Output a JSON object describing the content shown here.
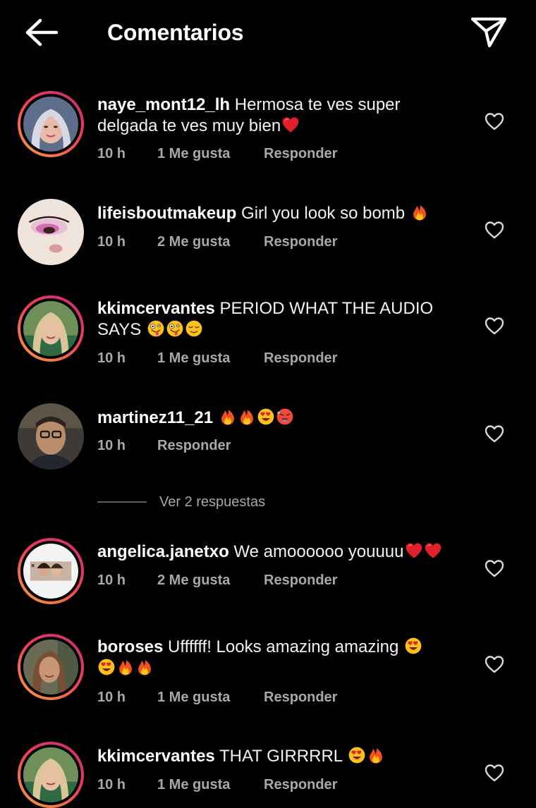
{
  "header": {
    "title": "Comentarios",
    "back_icon": "arrow-left-icon",
    "send_icon": "paper-plane-icon"
  },
  "colors": {
    "background": "#000000",
    "text": "#ffffff",
    "secondary_text": "#a8a8a8",
    "story_ring_start": "#f6a23a",
    "story_ring_end": "#c92a7e"
  },
  "comments": [
    {
      "username": "naye_mont12_lh",
      "line1": "Hermosa te ves super",
      "line2": "delgada te ves muy bien",
      "emojis": [
        "red-heart"
      ],
      "time": "10 h",
      "likes": "1 Me gusta",
      "reply": "Responder",
      "story_ring": true
    },
    {
      "username": "lifeisboutmakeup",
      "line1": "Girl you look so bomb",
      "emojis": [
        "fire"
      ],
      "time": "10 h",
      "likes": "2 Me gusta",
      "reply": "Responder",
      "story_ring": false
    },
    {
      "username": "kkimcervantes",
      "line1": "PERIOD WHAT THE AUDIO",
      "line2": "SAYS",
      "emojis": [
        "zany-face",
        "zany-face",
        "relieved-face"
      ],
      "time": "10 h",
      "likes": "1 Me gusta",
      "reply": "Responder",
      "story_ring": true
    },
    {
      "username": "martinez11_21",
      "emojis": [
        "fire",
        "fire",
        "heart-eyes-face",
        "hot-face"
      ],
      "time": "10 h",
      "reply": "Responder",
      "story_ring": false
    },
    {
      "username": "angelica.janetxo",
      "line1": "We amoooooo youuuu",
      "emojis": [
        "red-heart",
        "red-heart"
      ],
      "time": "10 h",
      "likes": "2 Me gusta",
      "reply": "Responder",
      "story_ring": true
    },
    {
      "username": "boroses",
      "line1": "Uffffff! Looks amazing amazing",
      "emojis": [
        "heart-eyes-face",
        "heart-eyes-face",
        "fire",
        "fire"
      ],
      "time": "10 h",
      "likes": "1 Me gusta",
      "reply": "Responder",
      "story_ring": true
    },
    {
      "username": "kkimcervantes",
      "line1": "THAT GIRRRRL",
      "emojis": [
        "heart-eyes-face",
        "fire"
      ],
      "time": "10 h",
      "likes": "1 Me gusta",
      "reply": "Responder",
      "story_ring": true
    }
  ],
  "view_replies": {
    "label": "Ver 2 respuestas"
  },
  "icons": {
    "like": "heart-outline-icon"
  }
}
